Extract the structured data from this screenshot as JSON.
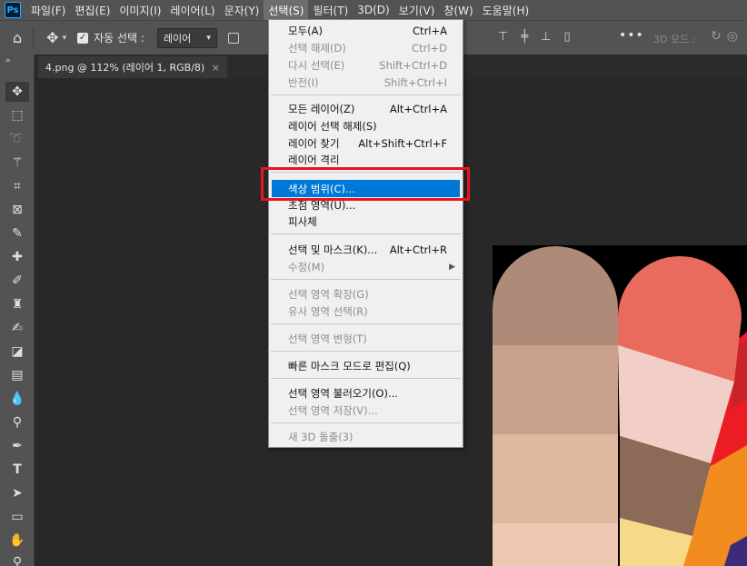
{
  "app": {
    "logo": "Ps"
  },
  "menubar": {
    "items": [
      "파일(F)",
      "편집(E)",
      "이미지(I)",
      "레이어(L)",
      "문자(Y)",
      "선택(S)",
      "필터(T)",
      "3D(D)",
      "보기(V)",
      "창(W)",
      "도움말(H)"
    ],
    "active_index": 5
  },
  "options": {
    "auto_select_label": "자동 선택 :",
    "auto_select_value": "레이어",
    "three_d_mode_label": "3D 모드 :",
    "more_label": "•••"
  },
  "document": {
    "tab_title": "4.png @ 112% (레이어 1, RGB/8)",
    "close_glyph": "×"
  },
  "dropdown": {
    "items": [
      {
        "label": "모두(A)",
        "shortcut": "Ctrl+A",
        "enabled": true
      },
      {
        "label": "선택 해제(D)",
        "shortcut": "Ctrl+D",
        "enabled": false
      },
      {
        "label": "다시 선택(E)",
        "shortcut": "Shift+Ctrl+D",
        "enabled": false
      },
      {
        "label": "반전(I)",
        "shortcut": "Shift+Ctrl+I",
        "enabled": false
      },
      {
        "label": "모든 레이어(Z)",
        "shortcut": "Alt+Ctrl+A",
        "enabled": true
      },
      {
        "label": "레이어 선택 해제(S)",
        "shortcut": "",
        "enabled": true
      },
      {
        "label": "레이어 찾기",
        "shortcut": "Alt+Shift+Ctrl+F",
        "enabled": true
      },
      {
        "label": "레이어 격리",
        "shortcut": "",
        "enabled": true
      },
      {
        "label": "색상 범위(C)...",
        "shortcut": "",
        "enabled": true,
        "highlighted": true
      },
      {
        "label": "초점 영역(U)...",
        "shortcut": "",
        "enabled": true
      },
      {
        "label": "피사체",
        "shortcut": "",
        "enabled": true
      },
      {
        "label": "선택 및 마스크(K)...",
        "shortcut": "Alt+Ctrl+R",
        "enabled": true
      },
      {
        "label": "수정(M)",
        "shortcut": "",
        "enabled": false,
        "submenu": true
      },
      {
        "label": "선택 영역 확장(G)",
        "shortcut": "",
        "enabled": false
      },
      {
        "label": "유사 영역 선택(R)",
        "shortcut": "",
        "enabled": false
      },
      {
        "label": "선택 영역 변형(T)",
        "shortcut": "",
        "enabled": false
      },
      {
        "label": "빠른 마스크 모드로 편집(Q)",
        "shortcut": "",
        "enabled": true
      },
      {
        "label": "선택 영역 불러오기(O)...",
        "shortcut": "",
        "enabled": true
      },
      {
        "label": "선택 영역 저장(V)...",
        "shortcut": "",
        "enabled": false
      },
      {
        "label": "새 3D 돌출(3)",
        "shortcut": "",
        "enabled": false
      }
    ]
  },
  "tools": [
    "move-tool",
    "marquee-tool",
    "lasso-tool",
    "magic-wand-tool",
    "crop-tool",
    "frame-tool",
    "eyedropper-tool",
    "healing-brush-tool",
    "brush-tool",
    "clone-stamp-tool",
    "history-brush-tool",
    "eraser-tool",
    "gradient-tool",
    "blur-tool",
    "dodge-tool",
    "pen-tool",
    "type-tool",
    "path-selection-tool",
    "rectangle-tool",
    "hand-tool",
    "zoom-tool"
  ],
  "artwork_colors": {
    "strip1": [
      "#b08a78",
      "#c9a08c",
      "#d8ae98",
      "#e0b89f",
      "#eec8b2"
    ],
    "strip2": [
      "#e86b5e",
      "#f2cfc6",
      "#8c6a58",
      "#f7d98a"
    ],
    "strip3": [
      "#c8232a",
      "#ec1c24",
      "#f28c1f",
      "#3b2b7a"
    ],
    "highlight_box": "#e8141e",
    "menu_highlight": "#0078d7"
  }
}
